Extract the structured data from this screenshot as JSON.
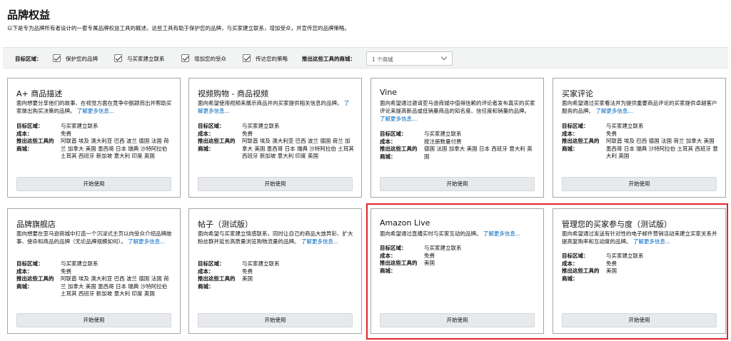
{
  "page": {
    "title": "品牌权益",
    "description": "以下是专为品牌所有者设计的一套专属品牌权益工具的概述。这些工具有助于保护您的品牌，与买家建立联系，增加受众，并宣传您的品牌策略。"
  },
  "filters": {
    "goal_label": "目标区域：",
    "checkboxes": [
      {
        "label": "保护您的品牌",
        "checked": true
      },
      {
        "label": "与买家建立联系",
        "checked": true
      },
      {
        "label": "增加您的受众",
        "checked": true
      },
      {
        "label": "传达您的策略",
        "checked": true
      }
    ],
    "market_label": "推出这些工具的商城：",
    "market_value": "1 个商城"
  },
  "field_labels": {
    "goal": "目标区域：",
    "cost": "成本：",
    "markets_line1": "推出这些工具的",
    "markets_line2": "商城："
  },
  "learn_more": "了解更多信息...",
  "start_label": "开始使用",
  "cards": [
    {
      "title": "A+ 商品描述",
      "desc": "面向想要分享他们的故事、在视觉方面在竞争中脱颖而出并帮助买家做出购买决策的品牌。",
      "goal": "与买家建立联系",
      "cost": "免费",
      "markets": "阿联酋 埃及 澳大利亚 巴西 波兰 德国 法国 荷兰 加拿大 美国 墨西哥 日本 瑞典 沙特阿拉伯 土耳其 西班牙 新加坡 意大利 印度 英国"
    },
    {
      "title": "视频购物 - 商品视频",
      "desc": "面向希望使用视频来展示商品并向买家提供相关信息的品牌。",
      "goal": "与买家建立联系",
      "cost": "免费",
      "markets": "阿联酋 埃及 澳大利亚 巴西 波兰 德国 荷兰 加拿大 美国 墨西哥 日本 瑞典 沙特阿拉伯 土耳其 西班牙 新加坡 意大利 印度 英国"
    },
    {
      "title": "Vine",
      "desc": "面向希望通过邀请亚马逊商城中值得信赖的评论者发布真实的买家评论来提高新品或低销量商品的知名度、信任度和销量的品牌。",
      "goal": "与买家建立联系",
      "cost": "按注册数量付费",
      "markets": "德国 法国 加拿大 美国 日本 西班牙 意大利 英国"
    },
    {
      "title": "买家评论",
      "desc": "面向希望通过买家看法并为提供重要商品评论的买家提供卓越客户服务的品牌。",
      "goal": "与买家建立联系",
      "cost": "免费",
      "markets": "阿联酋 埃及 巴西 德国 法国 荷兰 加拿大 美国 墨西哥 日本 瑞典 沙特阿拉伯 土耳其 西班牙 意大利 英国"
    },
    {
      "title": "品牌旗舰店",
      "desc": "面向想要在亚马逊商城中打造一个沉浸式主页以向受众介绍品牌故事、使命和商品的品牌（无论品牌规模如何）。",
      "goal": "与买家建立联系",
      "cost": "免费",
      "markets": "阿联酋 埃及 澳大利亚 巴西 波兰 德国 法国 荷兰 加拿大 美国 墨西哥 日本 瑞典 沙特阿拉伯 土耳其 西班牙 新加坡 意大利 印度 英国"
    },
    {
      "title": "帖子（测试版）",
      "desc": "面向希望与买家建立情感联系，同时让自己的商品大放异彩、扩大粉丝群并延长高质量浏览购物流量的品牌。",
      "goal": "与买家建立联系",
      "cost": "免费",
      "markets": "美国"
    },
    {
      "title": "Amazon Live",
      "desc": "面向希望通过直播实时与买家互动的品牌。",
      "goal": "与买家建立联系",
      "cost": "免费",
      "markets": "美国"
    },
    {
      "title": "管理您的买家参与度（测试版）",
      "desc": "面向希望通过发送有针对性的电子邮件营销活动来建立买家关系并提高复购率和互动度的品牌。",
      "goal": "与买家建立联系",
      "cost": "免费",
      "markets": "美国"
    }
  ],
  "colors": {
    "link": "#0066c0",
    "highlight_border": "#e0262c",
    "button_bg": "#e7e9ec",
    "filter_bar_bg": "#f2f3f3"
  }
}
